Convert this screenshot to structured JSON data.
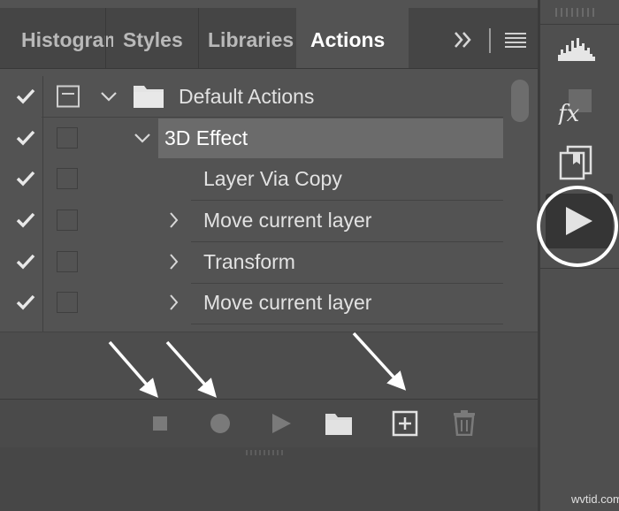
{
  "tabs": [
    {
      "label": "Histogram",
      "active": false
    },
    {
      "label": "Styles",
      "active": false
    },
    {
      "label": "Libraries",
      "active": false
    },
    {
      "label": "Actions",
      "active": true
    }
  ],
  "tab_overflow_icon": "double-chevron-right-icon",
  "panel_menu_icon": "hamburger-menu-icon",
  "actions": [
    {
      "label": "Default Actions",
      "type": "set",
      "checked": true,
      "dialog_toggle": true,
      "expanded": true
    },
    {
      "label": "3D Effect",
      "type": "action",
      "checked": true,
      "dialog_toggle": false,
      "expanded": true,
      "selected": true
    },
    {
      "label": "Layer Via Copy",
      "type": "step",
      "checked": true,
      "dialog_toggle": false
    },
    {
      "label": "Move current layer",
      "type": "step",
      "checked": true,
      "dialog_toggle": false,
      "expanded": false
    },
    {
      "label": "Transform",
      "type": "step",
      "checked": true,
      "dialog_toggle": false,
      "expanded": false
    },
    {
      "label": "Move current layer",
      "type": "step",
      "checked": true,
      "dialog_toggle": false,
      "expanded": false
    }
  ],
  "footer_buttons": [
    {
      "icon": "stop-icon",
      "state": "disabled"
    },
    {
      "icon": "record-icon",
      "state": "disabled"
    },
    {
      "icon": "play-icon",
      "state": "disabled"
    },
    {
      "icon": "new-set-folder-icon",
      "state": "enabled"
    },
    {
      "icon": "new-action-icon",
      "state": "enabled"
    },
    {
      "icon": "trash-icon",
      "state": "disabled"
    }
  ],
  "dock_icons": [
    "histogram-icon",
    "styles-fx-icon",
    "libraries-icon",
    "actions-play-icon"
  ],
  "annotations": {
    "arrow_color": "#ffffff",
    "circle_color": "#ffffff"
  },
  "colors": {
    "panel": "#535353",
    "selected_row": "#6b6b6b",
    "tab_bar": "#454545",
    "text": "#e2e2e2"
  },
  "watermark": "wvtid.com"
}
